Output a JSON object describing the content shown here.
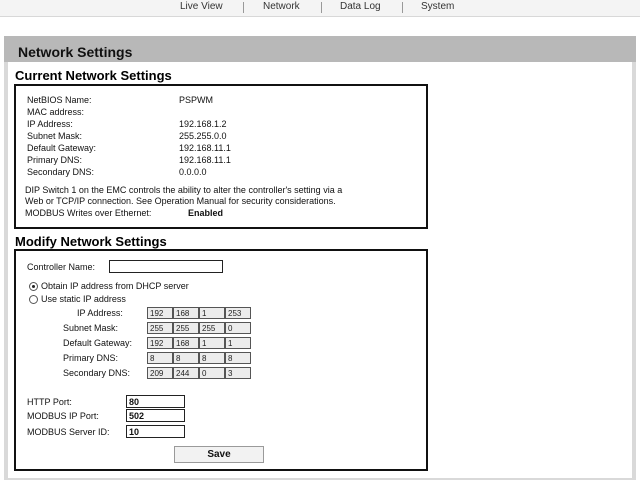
{
  "nav": {
    "items": [
      "Live View",
      "Network",
      "Data Log",
      "System"
    ]
  },
  "page": {
    "title": "Network Settings"
  },
  "current": {
    "title": "Current Network Settings",
    "rows": [
      {
        "label": "NetBIOS Name:",
        "value": "PSPWM"
      },
      {
        "label": "MAC address:",
        "value": ""
      },
      {
        "label": "IP Address:",
        "value": "192.168.1.2"
      },
      {
        "label": "Subnet Mask:",
        "value": "255.255.0.0"
      },
      {
        "label": "Default Gateway:",
        "value": "192.168.11.1"
      },
      {
        "label": "Primary DNS:",
        "value": "192.168.11.1"
      },
      {
        "label": "Secondary DNS:",
        "value": "0.0.0.0"
      }
    ],
    "note_line1": "DIP Switch 1 on the EMC controls the ability to alter the controller's setting via a",
    "note_line2": "Web or TCP/IP connection. See Operation Manual for security considerations.",
    "modbus_writes_label": "MODBUS Writes over Ethernet:",
    "modbus_writes_value": "Enabled"
  },
  "modify": {
    "title": "Modify Network Settings",
    "controller_name_label": "Controller Name:",
    "controller_name_value": "",
    "dhcp_label": "Obtain IP address from DHCP server",
    "dhcp_selected": true,
    "static_label": "Use static IP address",
    "static_selected": false,
    "ip_fields": [
      {
        "label": "IP Address:",
        "octets": [
          "192",
          "168",
          "1",
          "253"
        ]
      },
      {
        "label": "Subnet Mask:",
        "octets": [
          "255",
          "255",
          "255",
          "0"
        ]
      },
      {
        "label": "Default Gateway:",
        "octets": [
          "192",
          "168",
          "1",
          "1"
        ]
      },
      {
        "label": "Primary DNS:",
        "octets": [
          "8",
          "8",
          "8",
          "8"
        ]
      },
      {
        "label": "Secondary DNS:",
        "octets": [
          "209",
          "244",
          "0",
          "3"
        ]
      }
    ],
    "http_port_label": "HTTP Port:",
    "http_port_value": "80",
    "modbus_ip_port_label": "MODBUS IP Port:",
    "modbus_ip_port_value": "502",
    "modbus_server_id_label": "MODBUS Server ID:",
    "modbus_server_id_value": "10",
    "save_label": "Save"
  }
}
